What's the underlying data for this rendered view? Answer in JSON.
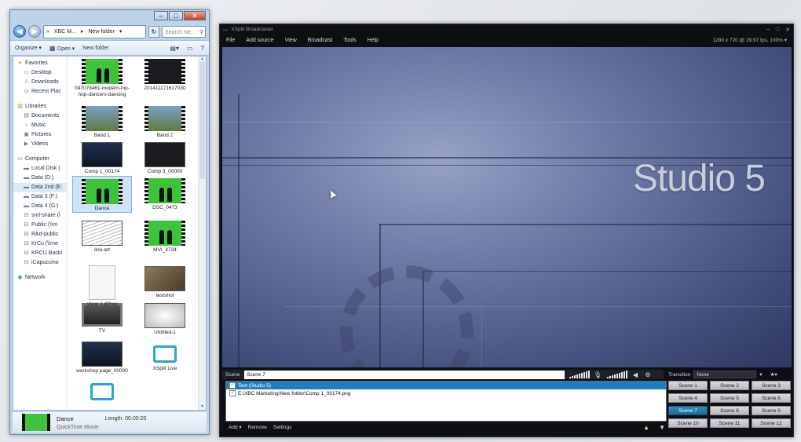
{
  "explorer": {
    "address": [
      "«",
      "XBC M...",
      "▸",
      "New folder",
      "▾"
    ],
    "search_placeholder": "Search Ne...",
    "toolbar": {
      "organize": "Organize ▾",
      "open": "Open ▾",
      "new_folder": "New folder"
    },
    "nav": [
      {
        "label": "Favorites",
        "level": 1,
        "icon": "star-icon"
      },
      {
        "label": "Desktop",
        "level": 2,
        "icon": "desktop-icon"
      },
      {
        "label": "Downloads",
        "level": 2,
        "icon": "downloads-icon"
      },
      {
        "label": "Recent Plac",
        "level": 2,
        "icon": "recent-places-icon"
      },
      {
        "gap": true
      },
      {
        "label": "Libraries",
        "level": 1,
        "icon": "libraries-icon"
      },
      {
        "label": "Documents",
        "level": 2,
        "icon": "documents-icon"
      },
      {
        "label": "Music",
        "level": 2,
        "icon": "music-icon"
      },
      {
        "label": "Pictures",
        "level": 2,
        "icon": "pictures-icon"
      },
      {
        "label": "Videos",
        "level": 2,
        "icon": "videos-icon"
      },
      {
        "gap": true
      },
      {
        "label": "Computer",
        "level": 1,
        "icon": "computer-icon"
      },
      {
        "label": "Local Disk (",
        "level": 2,
        "icon": "drive-icon"
      },
      {
        "label": "Data (D:)",
        "level": 2,
        "icon": "drive-icon"
      },
      {
        "label": "Data 2nd (E:",
        "level": 2,
        "icon": "drive-icon",
        "selected": true
      },
      {
        "label": "Data 3 (F:)",
        "level": 2,
        "icon": "drive-icon"
      },
      {
        "label": "Data 4 (G:)",
        "level": 2,
        "icon": "drive-icon"
      },
      {
        "label": "sml-share (\\",
        "level": 2,
        "icon": "network-drive-icon"
      },
      {
        "label": "Public (\\\\m",
        "level": 2,
        "icon": "network-drive-icon"
      },
      {
        "label": "R&d-public",
        "level": 2,
        "icon": "network-drive-icon"
      },
      {
        "label": "KrCu (\\\\me",
        "level": 2,
        "icon": "network-drive-icon"
      },
      {
        "label": "KRCU Backl",
        "level": 2,
        "icon": "network-drive-icon"
      },
      {
        "label": "iCapuccino",
        "level": 2,
        "icon": "network-drive-icon"
      },
      {
        "gap": true
      },
      {
        "label": "Network",
        "level": 1,
        "icon": "network-icon"
      }
    ],
    "files": [
      {
        "name": "047078461-modern-hip-hop-dancers-dancing",
        "kind": "video",
        "style": "green"
      },
      {
        "name": "201411171617030",
        "kind": "video",
        "style": "dark"
      },
      {
        "name": "Band 1",
        "kind": "video",
        "style": "outdoor"
      },
      {
        "name": "Band 2",
        "kind": "video",
        "style": "outdoor"
      },
      {
        "name": "Comp 1_00174",
        "kind": "image",
        "style": "navy"
      },
      {
        "name": "Comp 3_00000",
        "kind": "image",
        "style": "dark"
      },
      {
        "name": "Dance",
        "kind": "video",
        "style": "green",
        "selected": true
      },
      {
        "name": "DSC_0473",
        "kind": "video",
        "style": "green"
      },
      {
        "name": "line-art",
        "kind": "lineart",
        "style": "plain"
      },
      {
        "name": "MVI_4724",
        "kind": "video",
        "style": "green"
      },
      {
        "name": "show 1.8Pres",
        "kind": "doc",
        "style": "plain"
      },
      {
        "name": "testshot",
        "kind": "image",
        "style": "photo"
      },
      {
        "name": "TV",
        "kind": "tv",
        "style": "plain"
      },
      {
        "name": "Untitled-1",
        "kind": "image",
        "style": "white"
      },
      {
        "name": "workshop page_00000",
        "kind": "image",
        "style": "navy"
      },
      {
        "name": "XSplit Live",
        "kind": "logo",
        "style": "plain"
      },
      {
        "name": "",
        "kind": "logo",
        "style": "plain"
      }
    ],
    "details": {
      "name": "Dance",
      "type": "QuickTime Movie",
      "length_label": "Length:",
      "length": "00:00:20"
    }
  },
  "xsplit": {
    "title": "XSplit Broadcaster",
    "menu": [
      "File",
      "Add source",
      "View",
      "Broadcast",
      "Tools",
      "Help"
    ],
    "resolution": "1280 x 720 @ 29.97 fps, 100% ▾",
    "preview_text": "Studio 5",
    "scene_label": "Scene",
    "scene_name": "Scene 7",
    "sources": [
      {
        "label": "Text (Studio 5)",
        "checked": true,
        "selected": true
      },
      {
        "label": "E:\\XBC Marketing\\New folder\\Comp 1_00174.png",
        "checked": true,
        "selected": false
      }
    ],
    "source_actions": {
      "add": "Add ▾",
      "remove": "Remove",
      "settings": "Settings"
    },
    "transition_label": "Transition",
    "transition_value": "None",
    "scenes": [
      "Scene 1",
      "Scene 2",
      "Scene 3",
      "Scene 4",
      "Scene 5",
      "Scene 6",
      "Scene 7",
      "Scene 8",
      "Scene 9",
      "Scene 10",
      "Scene 11",
      "Scene 12"
    ],
    "active_scene": "Scene 7",
    "accent": "#1f7fc0"
  }
}
